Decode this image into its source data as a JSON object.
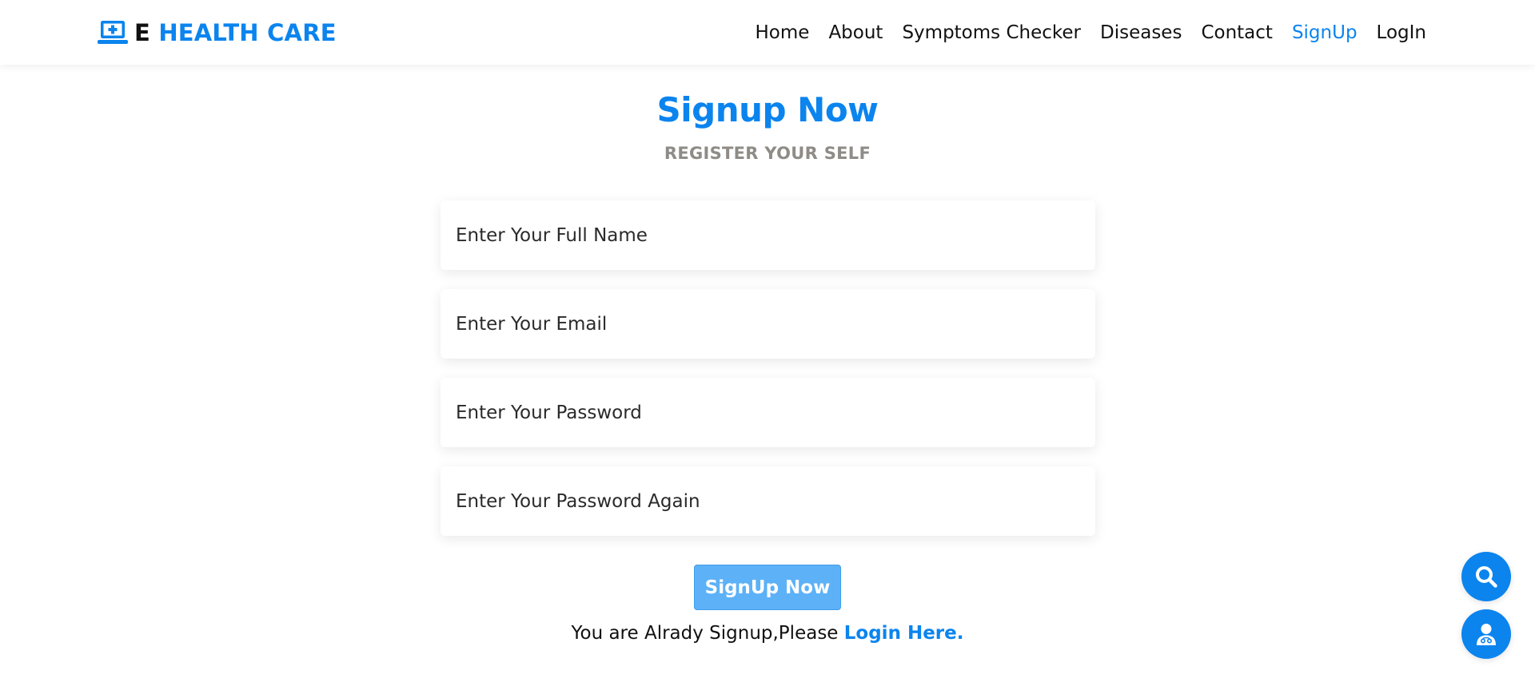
{
  "brand": {
    "prefix": "E",
    "name": "HEALTH CARE",
    "icon": "laptop-medical-icon",
    "color": "#0b84ee"
  },
  "nav": {
    "items": [
      {
        "label": "Home",
        "active": false
      },
      {
        "label": "About",
        "active": false
      },
      {
        "label": "Symptoms Checker",
        "active": false
      },
      {
        "label": "Diseases",
        "active": false
      },
      {
        "label": "Contact",
        "active": false
      },
      {
        "label": "SignUp",
        "active": true
      },
      {
        "label": "LogIn",
        "active": false
      }
    ]
  },
  "page": {
    "title": "Signup Now",
    "subtitle": "REGISTER YOUR SELF"
  },
  "form": {
    "full_name": {
      "placeholder": "Enter Your Full Name",
      "value": ""
    },
    "email": {
      "placeholder": "Enter Your Email",
      "value": ""
    },
    "password": {
      "placeholder": "Enter Your Password",
      "value": ""
    },
    "password_again": {
      "placeholder": "Enter Your Password Again",
      "value": ""
    },
    "submit_label": "SignUp Now"
  },
  "login_prompt": {
    "text": "You are Alrady Signup,Please ",
    "link_label": "Login Here."
  },
  "floating_buttons": [
    {
      "icon": "search-icon"
    },
    {
      "icon": "user-doctor-icon"
    }
  ],
  "colors": {
    "accent": "#0b84ee",
    "submit_button": "#5db1f7",
    "subtitle": "#8f8b86"
  }
}
